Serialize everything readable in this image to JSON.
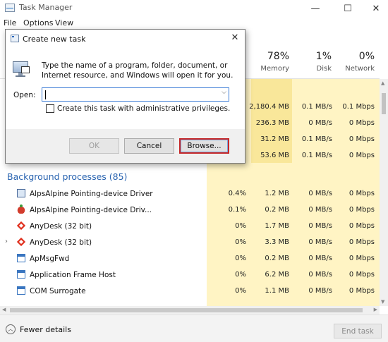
{
  "window": {
    "title": "Task Manager",
    "minimize_glyph": "—",
    "maximize_glyph": "☐",
    "close_glyph": "✕"
  },
  "menu": [
    "File",
    "Options",
    "View"
  ],
  "columns": {
    "memory": {
      "pct": "78%",
      "label": "Memory"
    },
    "disk": {
      "pct": "1%",
      "label": "Disk"
    },
    "network": {
      "pct": "0%",
      "label": "Network"
    }
  },
  "top_rows": [
    {
      "memory": "2,180.4 MB",
      "disk": "0.1 MB/s",
      "network": "0.1 Mbps"
    },
    {
      "memory": "236.3 MB",
      "disk": "0 MB/s",
      "network": "0 Mbps"
    },
    {
      "memory": "31.2 MB",
      "disk": "0.1 MB/s",
      "network": "0 Mbps"
    },
    {
      "memory": "53.6 MB",
      "disk": "0.1 MB/s",
      "network": "0 Mbps"
    }
  ],
  "background": {
    "heading": "Background processes (85)",
    "rows": [
      {
        "name": "AlpsAlpine Pointing-device Driver",
        "icon": "pointing-device-icon",
        "cpu": "0.4%",
        "memory": "1.2 MB",
        "disk": "0 MB/s",
        "network": "0 Mbps"
      },
      {
        "name": "AlpsAlpine Pointing-device Driv...",
        "icon": "alps-apple-icon",
        "cpu": "0.1%",
        "memory": "0.2 MB",
        "disk": "0 MB/s",
        "network": "0 Mbps"
      },
      {
        "name": "AnyDesk (32 bit)",
        "icon": "anydesk-icon",
        "cpu": "0%",
        "memory": "1.7 MB",
        "disk": "0 MB/s",
        "network": "0 Mbps"
      },
      {
        "name": "AnyDesk (32 bit)",
        "icon": "anydesk-icon",
        "cpu": "0%",
        "memory": "3.3 MB",
        "disk": "0 MB/s",
        "network": "0 Mbps",
        "expandable": true
      },
      {
        "name": "ApMsgFwd",
        "icon": "window-icon",
        "cpu": "0%",
        "memory": "0.2 MB",
        "disk": "0 MB/s",
        "network": "0 Mbps"
      },
      {
        "name": "Application Frame Host",
        "icon": "window-icon",
        "cpu": "0%",
        "memory": "6.2 MB",
        "disk": "0 MB/s",
        "network": "0 Mbps"
      },
      {
        "name": "COM Surrogate",
        "icon": "window-icon",
        "cpu": "0%",
        "memory": "1.1 MB",
        "disk": "0 MB/s",
        "network": "0 Mbps"
      }
    ]
  },
  "footer": {
    "fewer_details": "Fewer details",
    "end_task": "End task"
  },
  "dialog": {
    "title": "Create new task",
    "description": "Type the name of a program, folder, document, or Internet resource, and Windows will open it for you.",
    "open_label": "Open:",
    "open_value": "",
    "admin_label": "Create this task with administrative privileges.",
    "admin_checked": false,
    "ok_label": "OK",
    "cancel_label": "Cancel",
    "browse_label": "Browse..."
  },
  "colors": {
    "heat_light": "#fff4c4",
    "heat_dark": "#f9e79a",
    "section_heading": "#2a64b0",
    "highlight_border": "#c62828"
  }
}
